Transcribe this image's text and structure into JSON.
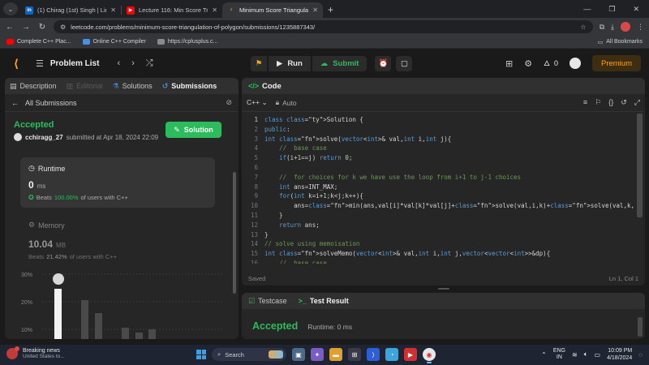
{
  "browser": {
    "tabs": [
      {
        "label": "(1) Chirag (1st) Singh | LinkedIn",
        "favicon": "in",
        "color": "#0a66c2",
        "active": false
      },
      {
        "label": "Lecture 116: Min Score Triangula",
        "favicon": "▶",
        "color": "#ff0000",
        "active": false
      },
      {
        "label": "Minimum Score Triangulation",
        "favicon": "⚡",
        "color": "#ffa116",
        "active": true
      }
    ],
    "url": "leetcode.com/problems/minimum-score-triangulation-of-polygon/submissions/1235887343/",
    "bookmarks": [
      {
        "label": "Complete C++ Plac...",
        "color": "#ff0000"
      },
      {
        "label": "Online C++ Compiler",
        "color": "#4a90e2"
      },
      {
        "label": "https://cplusplus.c...",
        "color": "#8a8a8a"
      }
    ],
    "all_bookmarks": "All Bookmarks"
  },
  "header": {
    "problem_list": "Problem List",
    "run": "Run",
    "submit": "Submit",
    "streak": "0",
    "premium": "Premium"
  },
  "left": {
    "tabs": [
      {
        "label": "Description",
        "icon": "description-icon",
        "state": "normal"
      },
      {
        "label": "Editorial",
        "icon": "editorial-icon",
        "state": "dim"
      },
      {
        "label": "Solutions",
        "icon": "solutions-icon",
        "state": "normal"
      },
      {
        "label": "Submissions",
        "icon": "submissions-icon",
        "state": "active"
      }
    ],
    "all_submissions": "All Submissions",
    "status": "Accepted",
    "username": "cchiragg_27",
    "submitted_at": "submitted at Apr 18, 2024 22:09",
    "solution_button": "Solution",
    "runtime": {
      "title": "Runtime",
      "value": "0",
      "unit": "ms",
      "beats_prefix": "Beats",
      "beats_pct": "100.00%",
      "beats_suffix": "of users with C++"
    },
    "memory": {
      "title": "Memory",
      "value": "10.04",
      "unit": "MB",
      "beats_prefix": "Beats",
      "beats_pct": "21.42%",
      "beats_suffix": "of users with C++"
    },
    "chart_y_labels": [
      "30%",
      "20%",
      "10%"
    ]
  },
  "code": {
    "title": "Code",
    "language": "C++",
    "auto": "Auto",
    "status": "Saved",
    "cursor": "Ln 1, Col 1",
    "current_line": 1,
    "lines": [
      "class Solution {",
      "public:",
      "int solve(vector<int>& val,int i,int j){",
      "    //  base case",
      "    if(i+1==j) return 0;",
      "",
      "    //  for choices for k we have use the loop from i+1 to j-1 choices",
      "    int ans=INT_MAX;",
      "    for(int k=i+1;k<j;k++){",
      "        ans=min(ans,val[i]*val[k]*val[j]+solve(val,i,k)+solve(val,k,j));",
      "    }",
      "    return ans;",
      "}",
      "// solve using memoisation",
      "int solveMemo(vector<int>& val,int i,int j,vector<vector<int>>&dp){",
      "    //  base case"
    ]
  },
  "test": {
    "testcase": "Testcase",
    "test_result": "Test Result",
    "result": "Accepted",
    "runtime": "Runtime: 0 ms"
  },
  "taskbar": {
    "news_title": "Breaking news",
    "news_sub": "United States to...",
    "search_placeholder": "Search",
    "lang_line1": "ENG",
    "lang_line2": "IN",
    "time": "10:09 PM",
    "date": "4/18/2024"
  }
}
